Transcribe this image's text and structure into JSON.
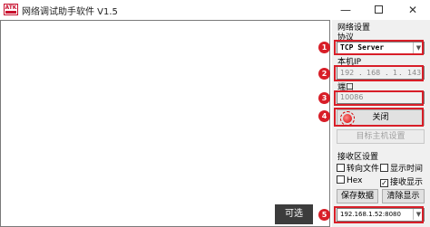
{
  "window": {
    "title": "网络调试助手软件 V1.5",
    "icon_label": "ATK",
    "minimize": "—",
    "close": "✕"
  },
  "settings": {
    "section_title": "网络设置",
    "protocol_label": "协议",
    "protocol_value": "TCP Server",
    "ip_label": "本机IP",
    "ip": [
      "192",
      "168",
      "1",
      "143"
    ],
    "port_label": "端口",
    "port_value": "10086",
    "close_button": "关闭",
    "target_button": "目标主机设置"
  },
  "receive": {
    "section_title": "接收区设置",
    "redirect_file": "转向文件",
    "show_time": "显示时间",
    "hex": "Hex",
    "hex_checked": false,
    "show_receive": "接收显示",
    "show_receive_checked": true,
    "save_button": "保存数据",
    "clear_button": "清除显示",
    "client_value": "192.168.1.52:8080"
  },
  "badges": [
    "1",
    "2",
    "3",
    "4",
    "5"
  ],
  "tooltip": "可选",
  "colors": {
    "highlight": "#d81e28",
    "led": "#d40000"
  }
}
